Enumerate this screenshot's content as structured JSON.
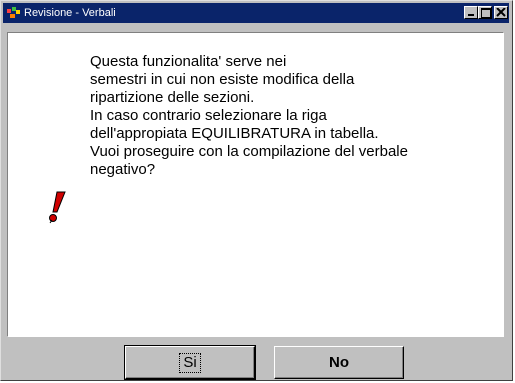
{
  "window": {
    "title": "Revisione - Verbali"
  },
  "message": {
    "lines": [
      "Questa funzionalita' serve nei",
      "semestri in cui non esiste modifica della",
      "ripartizione delle sezioni.",
      "In caso contrario selezionare la riga",
      "dell'appropiata EQUILIBRATURA in tabella.",
      "Vuoi proseguire con la compilazione del verbale",
      "negativo?"
    ]
  },
  "buttons": {
    "yes_label": "Si",
    "no_label": "No"
  },
  "icons": {
    "app": "app-icon",
    "warning": "exclamation-icon",
    "minimize": "minimize-icon",
    "maximize": "maximize-icon",
    "close": "close-icon"
  },
  "colors": {
    "titlebar": "#0a246a",
    "warning": "#cc0000",
    "face": "#c0c0c0"
  }
}
